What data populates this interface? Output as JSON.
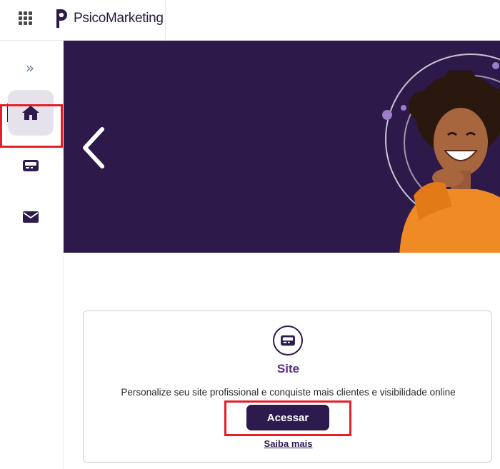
{
  "header": {
    "apps_icon": "grid-icon",
    "brand": "PsicoMarketing",
    "brand_color": "#2a1a3e"
  },
  "sidebar": {
    "expand_icon": "double-chevron-right-icon",
    "items": [
      {
        "name": "home",
        "icon": "home-icon",
        "active": true
      },
      {
        "name": "site",
        "icon": "card-icon",
        "highlighted": true
      },
      {
        "name": "mail",
        "icon": "envelope-icon"
      }
    ]
  },
  "banner": {
    "background": "#2d1a4a",
    "prev_icon": "chevron-left-icon"
  },
  "card": {
    "icon": "card-icon",
    "title": "Site",
    "description": "Personalize seu site profissional e conquiste mais clientes e visibilidade online",
    "button_label": "Acessar",
    "link_label": "Saiba mais",
    "accent": "#5a2e8c",
    "button_color": "#2d1b4e",
    "highlight_color": "#e3202a"
  }
}
